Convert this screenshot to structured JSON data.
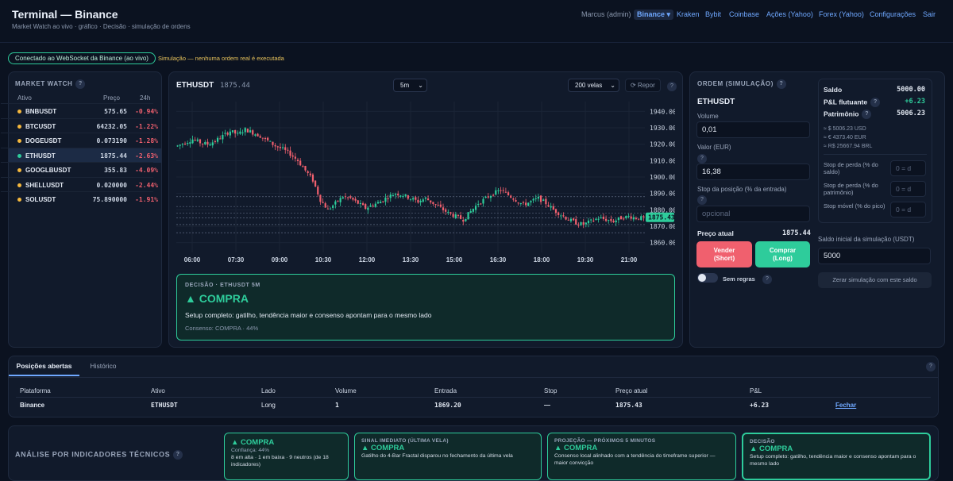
{
  "header": {
    "title": "Terminal — Binance",
    "subtitle": "Market Watch ao vivo · gráfico · Decisão · simulação de ordens",
    "nav": {
      "user": "Marcus (admin)",
      "binance": "Binance ▾",
      "kraken": "Kraken",
      "bybit": "Bybit",
      "coinbase": "Coinbase",
      "acoes": "Ações (Yahoo)",
      "forex": "Forex (Yahoo)",
      "config": "Configurações",
      "sair": "Sair"
    }
  },
  "status": {
    "ws": "Conectado ao WebSocket da Binance (ao vivo)",
    "sim": "Simulação — nenhuma ordem real é executada"
  },
  "market_watch": {
    "title": "MARKET WATCH",
    "col_asset": "Ativo",
    "col_price": "Preço",
    "col_change": "24h",
    "rows": [
      {
        "symbol": "BNBUSDT",
        "price": "575.65",
        "change": "-0.94%"
      },
      {
        "symbol": "BTCUSDT",
        "price": "64232.05",
        "change": "-1.22%"
      },
      {
        "symbol": "DOGEUSDT",
        "price": "0.073190",
        "change": "-1.28%"
      },
      {
        "symbol": "ETHUSDT",
        "price": "1875.44",
        "change": "-2.63%"
      },
      {
        "symbol": "GOOGLBUSDT",
        "price": "355.83",
        "change": "-4.09%"
      },
      {
        "symbol": "SHELLUSDT",
        "price": "0.020000",
        "change": "-2.44%"
      },
      {
        "symbol": "SOLUSDT",
        "price": "75.890000",
        "change": "-1.91%"
      }
    ]
  },
  "chart": {
    "symbol": "ETHUSDT",
    "price": "1875.44",
    "interval": "5m",
    "candles_label": "200 velas",
    "reset": "Repor"
  },
  "chart_data": {
    "type": "candlestick",
    "x_ticks": [
      "06:00",
      "07:30",
      "09:00",
      "10:30",
      "12:00",
      "13:30",
      "15:00",
      "16:30",
      "18:00",
      "19:30",
      "21:00"
    ],
    "y_ticks": [
      1940,
      1930,
      1920,
      1910,
      1900,
      1890,
      1880,
      1870,
      1860
    ],
    "ylim": [
      1854,
      1946
    ],
    "last_price": "1875.43",
    "close_series": [
      1919,
      1921,
      1923,
      1921,
      1920,
      1922,
      1925,
      1928,
      1926,
      1929,
      1927,
      1925,
      1922,
      1919,
      1917,
      1914,
      1910,
      1904,
      1898,
      1886,
      1880,
      1884,
      1888,
      1887,
      1884,
      1881,
      1883,
      1885,
      1888,
      1890,
      1889,
      1887,
      1885,
      1887,
      1884,
      1881,
      1878,
      1876,
      1874,
      1879,
      1884,
      1887,
      1890,
      1892,
      1889,
      1886,
      1883,
      1885,
      1887,
      1884,
      1880,
      1877,
      1874,
      1872,
      1871,
      1873,
      1875,
      1874,
      1873,
      1875,
      1876,
      1875,
      1875
    ],
    "dashed_levels": [
      1888,
      1882,
      1878,
      1875,
      1871,
      1866
    ]
  },
  "decision": {
    "label": "DECISÃO · ETHUSDT 5M",
    "signal": "▲ COMPRA",
    "text": "Setup completo: gatilho, tendência maior e consenso apontam para o mesmo lado",
    "consensus": "Consenso: COMPRA · 44%"
  },
  "order": {
    "title": "ORDEM (SIMULAÇÃO)",
    "symbol": "ETHUSDT",
    "volume_label": "Volume",
    "volume": "0,01",
    "value_label": "Valor (EUR)",
    "value": "16,38",
    "stop_label": "Stop da posição (% da entrada)",
    "stop_placeholder": "opcional",
    "price_label": "Preço atual",
    "price": "1875.44",
    "sell": "Vender",
    "sell_sub": "(Short)",
    "buy": "Comprar",
    "buy_sub": "(Long)",
    "no_rules": "Sem regras",
    "balance_label": "Saldo",
    "balance": "5000.00",
    "pnl_label": "P&L flutuante",
    "pnl": "+6.23",
    "equity_label": "Patrimônio",
    "equity": "5006.23",
    "conv_usd": "≈ $ 5006.23 USD",
    "conv_eur": "≈ € 4373.40 EUR",
    "conv_brl": "≈ R$ 25667.94 BRL",
    "stop_balance": "Stop de perda (% do saldo)",
    "stop_equity": "Stop de perda (% do patrimônio)",
    "stop_peak": "Stop móvel (% do pico)",
    "stop_ph": "0 = d",
    "init_label": "Saldo inicial da simulação (USDT)",
    "init_value": "5000",
    "reset_btn": "Zerar simulação com este saldo"
  },
  "positions": {
    "tab_open": "Posições abertas",
    "tab_history": "Histórico",
    "cols": [
      "Plataforma",
      "Ativo",
      "Lado",
      "Volume",
      "Entrada",
      "Stop",
      "Preço atual",
      "P&L"
    ],
    "row": [
      "Binance",
      "ETHUSDT",
      "Long",
      "1",
      "1869.20",
      "—",
      "1875.43",
      "+6.23"
    ],
    "close": "Fechar"
  },
  "analysis": {
    "title": "ANÁLISE POR INDICADORES TÉCNICOS",
    "c1": {
      "signal": "▲ COMPRA",
      "conf": "Confiança: 44%",
      "text": "8 em alta · 1 em baixa · 9 neutros (de 18 indicadores)"
    },
    "c2": {
      "label": "SINAL IMEDIATO (ÚLTIMA VELA)",
      "signal": "▲ COMPRA",
      "text": "Gatilho do 4-Bar Fractal disparou no fechamento da última vela"
    },
    "c3": {
      "label": "PROJEÇÃO — PRÓXIMOS 5 MINUTOS",
      "signal": "▲ COMPRA",
      "text": "Consenso local alinhado com a tendência do timeframe superior — maior convicção"
    },
    "c4": {
      "label": "DECISÃO",
      "signal": "▲ COMPRA",
      "text": "Setup completo: gatilho, tendência maior e consenso apontam para o mesmo lado"
    }
  }
}
